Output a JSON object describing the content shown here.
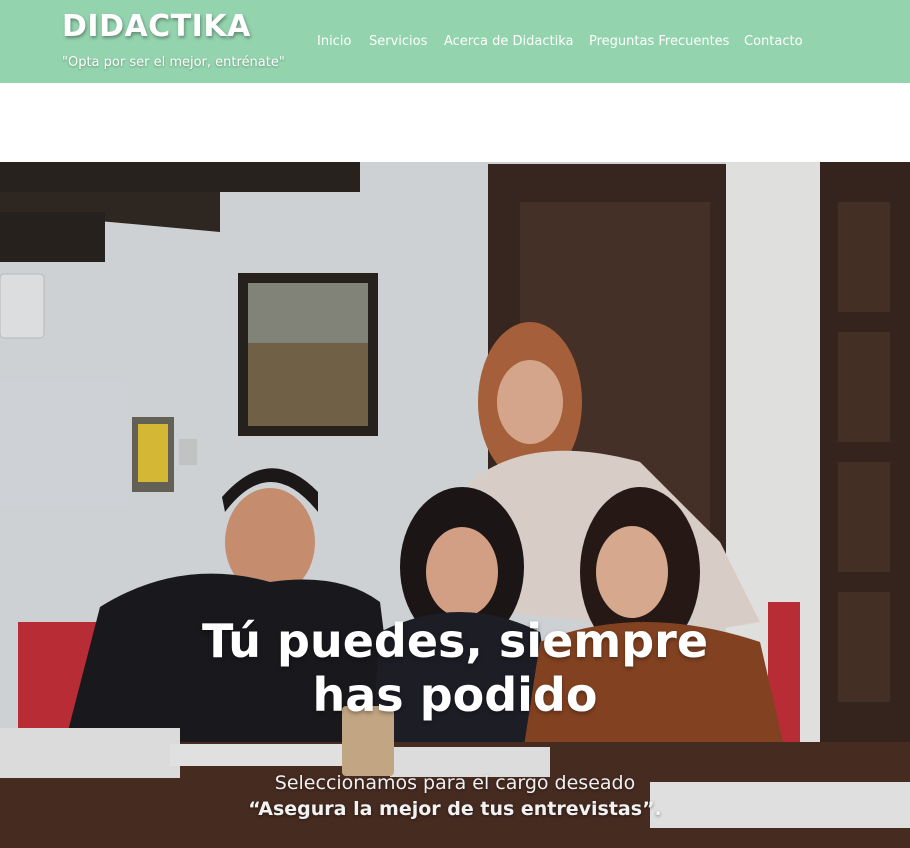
{
  "site": {
    "title": "DIDACTIKA",
    "tagline": "\"Opta por ser el mejor, entrénate\""
  },
  "nav": {
    "items": [
      {
        "label": "Inicio"
      },
      {
        "label": "Servicios"
      },
      {
        "label": "Acerca de Didactika"
      },
      {
        "label": "Preguntas Frecuentes"
      },
      {
        "label": "Contacto"
      }
    ]
  },
  "hero": {
    "headline_line1": "Tú puedes, siempre",
    "headline_line2": "has podido",
    "subtitle": "Seleccionamos para el cargo deseado",
    "quote": "“Asegura la mejor de tus entrevistas”."
  },
  "colors": {
    "header_bg": "#93d3ad",
    "header_text": "#ffffff"
  }
}
